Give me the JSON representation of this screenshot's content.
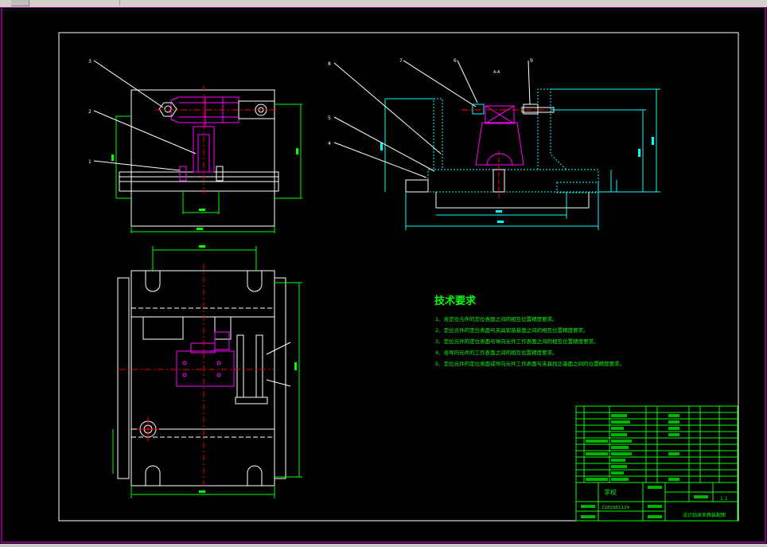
{
  "window": {
    "background": "#000000",
    "frame_color": "#ff00ff"
  },
  "colors": {
    "outline": "#ffffff",
    "dimension": "#00ff00",
    "part_magenta": "#ff00ff",
    "centerline": "#ff0000",
    "hatch": "#00ffff",
    "leader": "#ffffff",
    "title_table": "#00ff00",
    "notes_text": "#00ff00"
  },
  "drawing": {
    "tech_title": "技术要求",
    "tech_notes": [
      "1、各定位元件的定位表面之间的相互位置精度要求。",
      "2、定位元件的定位表面与夹具安装基面之间的相互位置精度要求。",
      "3、定位元件的定位表面与导向元件工作表面之间的相互位置精度要求。",
      "4、各导向元件的工作表面之间的相互位置精度要求。",
      "5、定位元件的定位表面或导向元件工作表面与夹具找正基面之间的位置精度要求。"
    ],
    "leader_labels": [
      "3",
      "2",
      "1",
      "8",
      "7",
      "5",
      "4",
      "6",
      "9"
    ],
    "section_label": "A-A",
    "title_block": {
      "school_label": "学校",
      "student_id": "2182961124",
      "scale": "1:1",
      "drawing_title": "设计钻床夹具装配图"
    }
  }
}
